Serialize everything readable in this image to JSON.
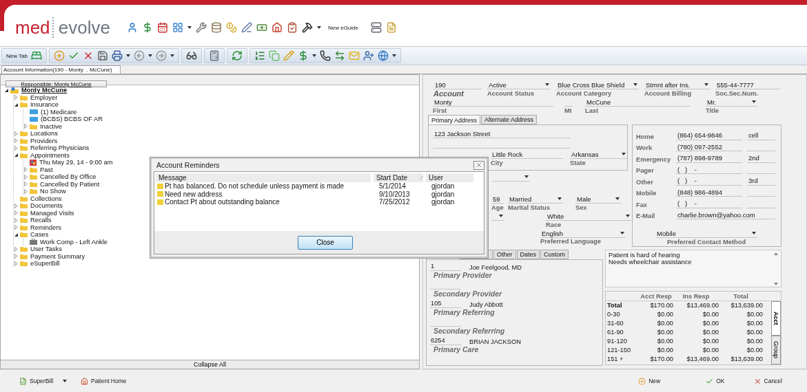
{
  "header": {
    "logo": [
      "med",
      "evolve"
    ],
    "eguide_link": "New eGuide"
  },
  "toolbar": {
    "new_tab_button": "New Tab"
  },
  "document_tabs": [
    {
      "label": "Account Information(190 - Monty  . McCune)",
      "selected": true
    }
  ],
  "responsible_button": "Responsible: Monty McCune",
  "tree": [
    {
      "label": "Monty McCune",
      "kind": "patient",
      "expanded": true,
      "children": [
        {
          "label": "Employer",
          "kind": "folder",
          "expanded": false
        },
        {
          "label": "Insurance",
          "kind": "folder",
          "expanded": true,
          "children": [
            {
              "label": "(1) Medicare",
              "kind": "card"
            },
            {
              "label": "(BCBS) BCBS OF AR",
              "kind": "card"
            },
            {
              "label": "Inactive",
              "kind": "folder",
              "expanded": false
            }
          ]
        },
        {
          "label": "Locations",
          "kind": "folder",
          "expanded": false
        },
        {
          "label": "Providers",
          "kind": "folder",
          "expanded": false
        },
        {
          "label": "Referring Physicians",
          "kind": "folder",
          "expanded": false
        },
        {
          "label": "Appointments",
          "kind": "folder",
          "expanded": true,
          "children": [
            {
              "label": "Thu May 29, 14 - 9:00 am",
              "kind": "appointment"
            },
            {
              "label": "Past",
              "kind": "folder",
              "expanded": false
            },
            {
              "label": "Cancelled By Office",
              "kind": "folder",
              "expanded": false
            },
            {
              "label": "Cancelled By Patient",
              "kind": "folder",
              "expanded": false
            },
            {
              "label": "No Show",
              "kind": "folder",
              "expanded": false
            }
          ]
        },
        {
          "label": "Collections",
          "kind": "folder"
        },
        {
          "label": "Documents",
          "kind": "folder",
          "expanded": false
        },
        {
          "label": "Managed Visits",
          "kind": "folder",
          "expanded": false
        },
        {
          "label": "Recalls",
          "kind": "folder",
          "expanded": false
        },
        {
          "label": "Reminders",
          "kind": "folder",
          "expanded": false
        },
        {
          "label": "Cases",
          "kind": "folder",
          "expanded": true,
          "children": [
            {
              "label": "Work Comp - Left Ankle",
              "kind": "case"
            }
          ]
        },
        {
          "label": "User Tasks",
          "kind": "folder",
          "expanded": false
        },
        {
          "label": "Payment Summary",
          "kind": "folder",
          "expanded": false
        },
        {
          "label": "eSuperBill",
          "kind": "folder",
          "expanded": false
        }
      ]
    }
  ],
  "collapse_all_button": "Collapse All",
  "account_row": [
    {
      "value": "190",
      "label": "Account",
      "kind": "text"
    },
    {
      "value": "Active",
      "label": "Account Status",
      "kind": "select"
    },
    {
      "value": "Blue Cross Blue Shield",
      "label": "Account Category",
      "kind": "select"
    },
    {
      "value": "Stmnt after Ins.",
      "label": "Account Billing",
      "kind": "select"
    },
    {
      "value": "555-44-7777",
      "label": "Soc.Sec.Num.",
      "kind": "text"
    }
  ],
  "name_row": [
    {
      "value": "Monty",
      "label": "First",
      "kind": "text"
    },
    {
      "label": "MI",
      "kind": "text"
    },
    {
      "value": "McCune",
      "label": "Last",
      "kind": "text"
    },
    {
      "value": "Mr.",
      "label": "Title",
      "kind": "select"
    }
  ],
  "address_tabs": [
    {
      "label": "Primary Address",
      "selected": true
    },
    {
      "label": "Alternate Address",
      "selected": false
    }
  ],
  "address": {
    "street": "123 Jackson Street",
    "city": {
      "value": "Little Rock",
      "label": "City",
      "kind": "text"
    },
    "state": {
      "value": "Arkansas",
      "label": "State",
      "kind": "select"
    }
  },
  "demographics": {
    "age": {
      "value": "59",
      "label": "Age",
      "kind": "text"
    },
    "marital_status": {
      "value": "Married",
      "label": "Marital Status",
      "kind": "select"
    },
    "sex": {
      "value": "Male",
      "label": "Sex",
      "kind": "select"
    },
    "race": {
      "value": "White",
      "label": "Race",
      "kind": "select"
    },
    "language": {
      "value": "English",
      "label": "Preferred Language",
      "kind": "select"
    }
  },
  "phones": [
    {
      "label": "Home",
      "value": "(864) 654-9846",
      "note": "cell",
      "kind": "phone"
    },
    {
      "label": "Work",
      "value": "(780) 097-2552",
      "kind": "phone"
    },
    {
      "label": "Emergency",
      "value": "(787) 898-9789",
      "note": "2nd",
      "kind": "phone"
    },
    {
      "label": "Pager",
      "value": "(   )    -",
      "kind": "phone"
    },
    {
      "label": "Other",
      "value": "(   )    -",
      "note": "3rd",
      "kind": "phone"
    },
    {
      "label": "Mobile",
      "value": "(848) 986-4894",
      "kind": "phone"
    },
    {
      "label": "Fax",
      "value": "(   )    -",
      "kind": "phone"
    },
    {
      "label": "E-Mail",
      "value": "charlie.brown@yahoo.com",
      "kind": "email"
    }
  ],
  "contact_method": {
    "value": "Mobile",
    "label": "Preferred Contact Method",
    "kind": "select"
  },
  "provider_tabs": [
    {
      "label": "Other",
      "selected": false
    },
    {
      "label": "Dates",
      "selected": false
    },
    {
      "label": "Custom",
      "selected": false
    }
  ],
  "providers": [
    {
      "code": "1",
      "name": "Joe Feelgood, MD",
      "role": "Primary Provider"
    },
    {
      "role": "Secondary Provider"
    },
    {
      "code": "105",
      "name": "Judy Abbott",
      "role": "Primary Referring"
    },
    {
      "role": "Secondary  Referring"
    },
    {
      "code": "6254",
      "name": "BRIAN JACKSON",
      "role": "Primary Care"
    }
  ],
  "notes": [
    "Patient is hard of hearing",
    "Needs wheelchair assistance"
  ],
  "aging": {
    "columns": [
      "Acct Resp",
      "Ins Resp",
      "Total"
    ],
    "rows": [
      {
        "kind": "total",
        "label": "Total",
        "values": [
          "$170.00",
          "$13,469.00",
          "$13,639.00"
        ]
      },
      {
        "kind": "bucket",
        "label": "0-30",
        "values": [
          "$0.00",
          "$0.00",
          "$0.00"
        ]
      },
      {
        "kind": "bucket",
        "label": "31-60",
        "values": [
          "$0.00",
          "$0.00",
          "$0.00"
        ]
      },
      {
        "kind": "bucket",
        "label": "61-90",
        "values": [
          "$0.00",
          "$0.00",
          "$0.00"
        ]
      },
      {
        "kind": "bucket",
        "label": "91-120",
        "values": [
          "$0.00",
          "$0.00",
          "$0.00"
        ]
      },
      {
        "kind": "bucket",
        "label": "121-150",
        "values": [
          "$0.00",
          "$0.00",
          "$0.00"
        ]
      },
      {
        "kind": "bucket",
        "label": "151 +",
        "values": [
          "$170.00",
          "$13,469.00",
          "$13,639.00"
        ]
      }
    ],
    "side_tabs": [
      {
        "label": "Acct",
        "selected": true
      },
      {
        "label": "Group",
        "selected": false
      }
    ]
  },
  "reminders_dialog": {
    "title": "Account Reminders",
    "columns": [
      {
        "label": "Message",
        "sorted": false
      },
      {
        "label": "Start Date",
        "sorted": true
      },
      {
        "label": "User",
        "sorted": false
      }
    ],
    "rows": [
      {
        "message": "Pt has balanced. Do not schedule unless payment is made",
        "start_date": "5/1/2014",
        "user": "gjordan"
      },
      {
        "message": "Need new address",
        "start_date": "9/10/2013",
        "user": "gjordan"
      },
      {
        "message": "Contact Pt about outstanding balance",
        "start_date": "7/25/2012",
        "user": "gjordan"
      }
    ],
    "close_button": "Close"
  },
  "footer": {
    "left_buttons": [
      {
        "label": "SuperBill",
        "kind": "superbill",
        "menu": true
      },
      {
        "label": "Patient Home",
        "kind": "patient-home",
        "menu": false
      }
    ],
    "right_buttons": [
      {
        "label": "New",
        "kind": "new"
      },
      {
        "label": "OK",
        "kind": "ok"
      },
      {
        "label": "Cancel",
        "kind": "cancel"
      }
    ]
  }
}
